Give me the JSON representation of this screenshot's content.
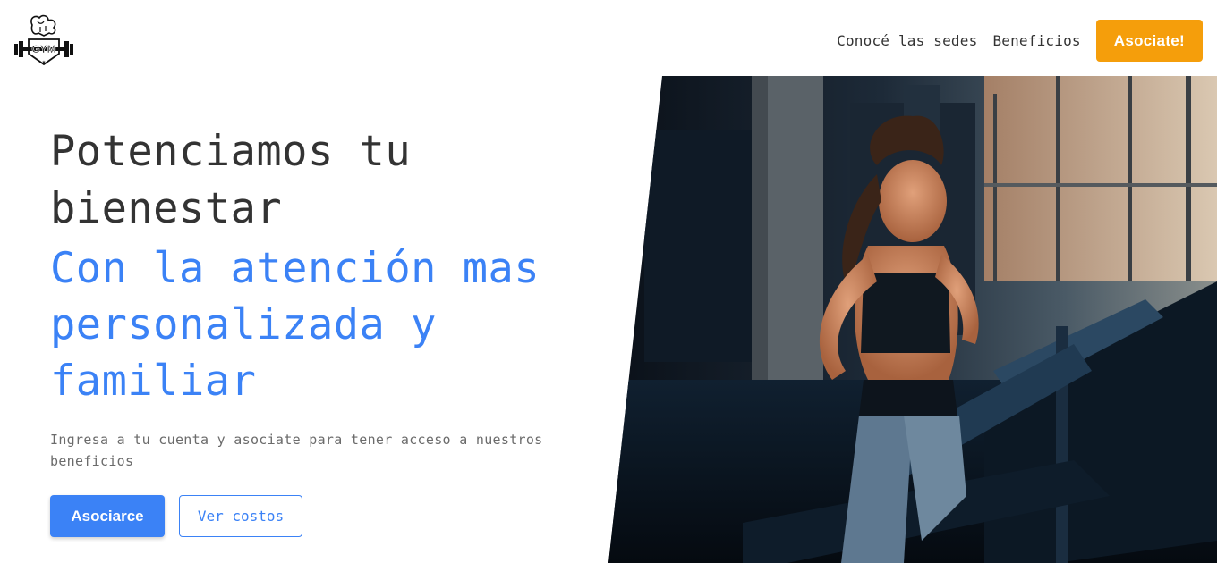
{
  "brand": {
    "logo_text": "GYM"
  },
  "nav": {
    "links": [
      "Conocé las sedes",
      "Beneficios"
    ],
    "cta_label": "Asociate!"
  },
  "hero": {
    "title_line1": "Potenciamos tu",
    "title_line2": "bienestar",
    "subtitle_line1": "Con la atención mas",
    "subtitle_line2": "personalizada y",
    "subtitle_line3": "familiar",
    "description": "Ingresa a tu cuenta y asociate para tener acceso a nuestros beneficios",
    "primary_button": "Asociarce",
    "secondary_button": "Ver costos"
  },
  "colors": {
    "accent_orange": "#f59e0b",
    "accent_blue": "#3b82f6"
  },
  "image": {
    "subject": "woman-running-on-treadmill-photo"
  }
}
